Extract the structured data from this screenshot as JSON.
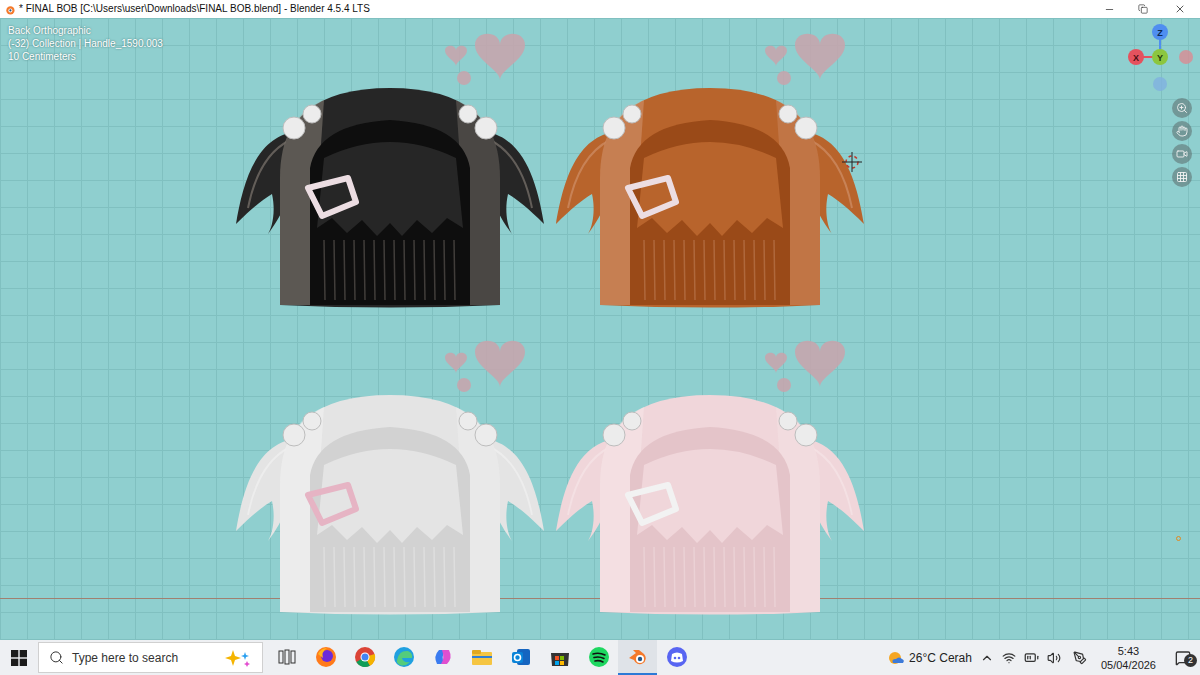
{
  "window": {
    "title": "* FINAL BOB [C:\\Users\\user\\Downloads\\FINAL BOB.blend] - Blender 4.5.4 LTS"
  },
  "viewport": {
    "overlay": [
      "Back Orthographic",
      "(-32) Collection | Handle_1590.003",
      "10 Centimeters"
    ],
    "gizmo": [
      {
        "label": "Z",
        "color": "#4f8ef0"
      },
      {
        "label": "X",
        "color": "#e5525e"
      },
      {
        "label": "Y",
        "color": "#8cc63f"
      }
    ],
    "models": [
      {
        "hair": "#262626",
        "shade": "#0e0e0e",
        "highlight": "#a0968c",
        "clip": "#ecdde2"
      },
      {
        "hair": "#b8642c",
        "shade": "#9a4a18",
        "highlight": "#d8a080",
        "clip": "#ecdde2"
      },
      {
        "hair": "#e4e4e4",
        "shade": "#d2d2d2",
        "highlight": "#f6f6f6",
        "clip": "#e6b4c4"
      },
      {
        "hair": "#f0d6da",
        "shade": "#e4c4c9",
        "highlight": "#f8eaec",
        "clip": "#f2f2f2"
      }
    ]
  },
  "taskbar": {
    "search_placeholder": "Type here to search",
    "apps": [
      {
        "active": false
      },
      {
        "active": false
      },
      {
        "active": false
      },
      {
        "active": false
      },
      {
        "active": false
      },
      {
        "active": false
      },
      {
        "active": false
      },
      {
        "active": false
      },
      {
        "active": false
      },
      {
        "active": true
      },
      {
        "active": false
      }
    ],
    "weather": "26°C Cerah",
    "time": "5:43",
    "date": "05/04/2026",
    "notifications": "2"
  }
}
